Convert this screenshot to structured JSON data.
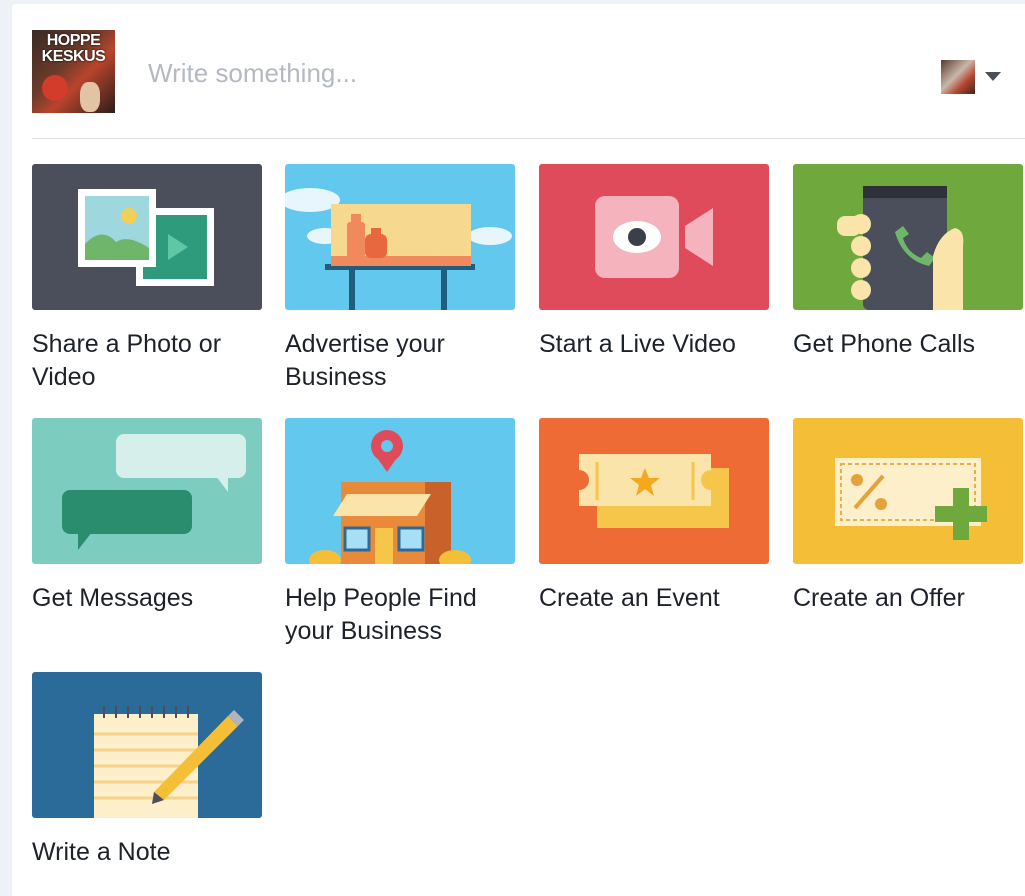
{
  "composer": {
    "page_logo_text": "HOPPE KESKUS",
    "placeholder": "Write something...",
    "post_as_icon": "chevron-down-icon"
  },
  "actions": [
    {
      "label": "Share a Photo or Video",
      "icon": "photo-video-icon",
      "bg": "#4b4f5c"
    },
    {
      "label": "Advertise your Business",
      "icon": "billboard-icon",
      "bg": "#62c8ee"
    },
    {
      "label": "Start a Live Video",
      "icon": "live-video-icon",
      "bg": "#e04b5c"
    },
    {
      "label": "Get Phone Calls",
      "icon": "phone-call-icon",
      "bg": "#6fa83d"
    },
    {
      "label": "Get Messages",
      "icon": "messages-icon",
      "bg": "#7ccdc0"
    },
    {
      "label": "Help People Find your Business",
      "icon": "store-location-icon",
      "bg": "#62c8ee"
    },
    {
      "label": "Create an Event",
      "icon": "event-ticket-icon",
      "bg": "#ee6b36"
    },
    {
      "label": "Create an Offer",
      "icon": "offer-coupon-icon",
      "bg": "#f4bf37"
    },
    {
      "label": "Write a Note",
      "icon": "note-pad-icon",
      "bg": "#2b6b99"
    }
  ]
}
